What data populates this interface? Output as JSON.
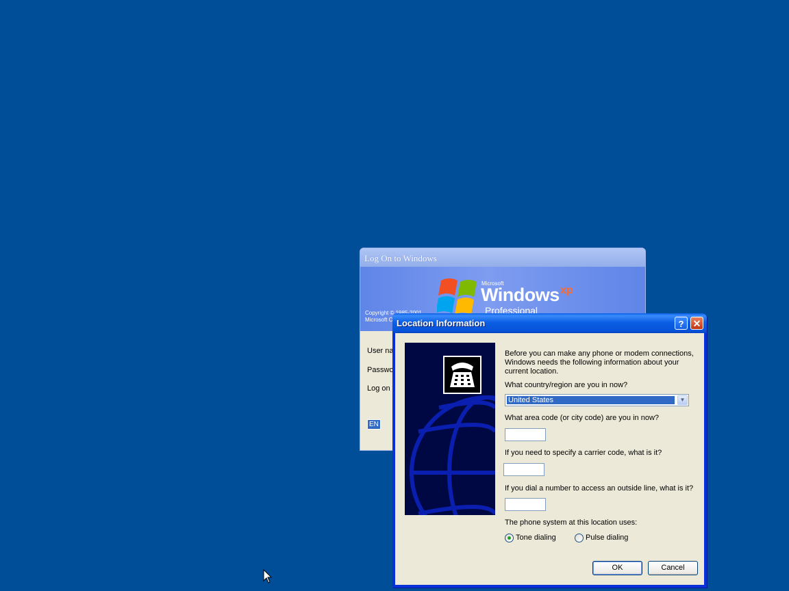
{
  "logon": {
    "title": "Log On to Windows",
    "copyright_line1": "Copyright © 1985-2001",
    "copyright_line2": "Microsoft C",
    "brand_microsoft": "Microsoft",
    "brand_windows": "Windows",
    "brand_xp": "xp",
    "brand_edition": "Professional",
    "user_label": "User na",
    "password_label": "Passwo",
    "logon_to_label": "Log on t",
    "language": "EN"
  },
  "location_dialog": {
    "title": "Location Information",
    "help_glyph": "?",
    "close_glyph": "✕",
    "intro": "Before you can make any phone or modem connections, Windows needs the following information about your current location.",
    "country_label": "What country/region are you in now?",
    "country_value": "United States",
    "area_code_label": "What area code (or city code) are you in now?",
    "area_code_value": "",
    "carrier_label": "If you need to specify a carrier code, what is it?",
    "carrier_value": "",
    "outside_line_label": "If you dial a number to access an outside line, what is it?",
    "outside_line_value": "",
    "phone_system_label": "The phone system at this location uses:",
    "tone_label": "Tone dialing",
    "pulse_label": "Pulse dialing",
    "selected_dialing": "tone",
    "ok_label": "OK",
    "cancel_label": "Cancel"
  },
  "colors": {
    "desktop": "#004E98",
    "titlebar": "#0A5FE6",
    "dialog_face": "#ECE9D8",
    "selection": "#316AC5"
  }
}
